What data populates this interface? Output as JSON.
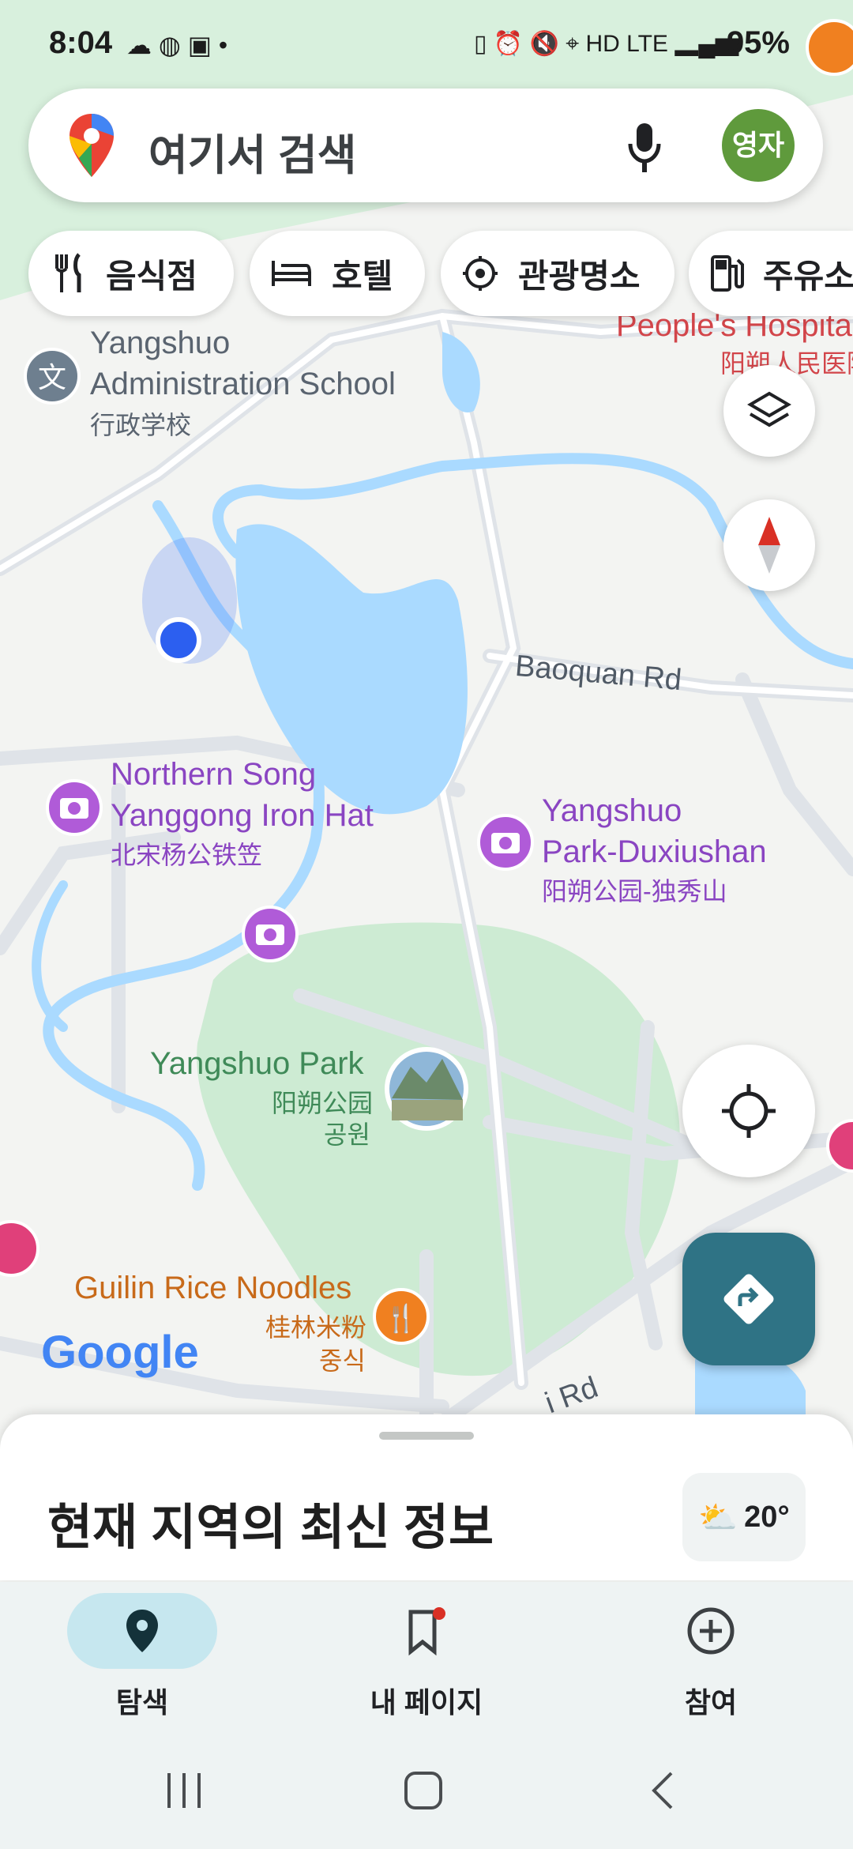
{
  "status_bar": {
    "time": "8:04",
    "battery": "95%"
  },
  "search": {
    "placeholder": "여기서 검색",
    "avatar_text": "영자"
  },
  "chips": [
    {
      "label": "음식점",
      "icon": "fork-knife-icon"
    },
    {
      "label": "호텔",
      "icon": "bed-icon"
    },
    {
      "label": "관광명소",
      "icon": "attraction-icon"
    },
    {
      "label": "주유소",
      "icon": "gas-station-icon"
    }
  ],
  "map": {
    "labels": {
      "admin_school_en1": "Yangshuo",
      "admin_school_en2": "Administration School",
      "admin_school_zh": "行政学校",
      "hospital_en": "People's Hospital",
      "hospital_zh": "阳朔人民医院",
      "baoquan_rd": "Baoquan Rd",
      "northern_song_en1": "Northern Song",
      "northern_song_en2": "Yanggong Iron Hat",
      "northern_song_zh": "北宋杨公铁笠",
      "duxiushan_en1": "Yangshuo",
      "duxiushan_en2": "Park-Duxiushan",
      "duxiushan_zh": "阳朔公园-独秀山",
      "park_en": "Yangshuo Park",
      "park_zh": "阳朔公园",
      "park_ko": "공원",
      "noodles_en": "Guilin Rice Noodles",
      "noodles_zh": "桂林米粉",
      "noodles_ko": "중식",
      "road_bottom": "i Rd",
      "google_logo": "Google"
    }
  },
  "sheet": {
    "title": "현재 지역의 최신 정보",
    "temperature": "20°"
  },
  "bottom_nav": [
    {
      "label": "탐색",
      "active": true
    },
    {
      "label": "내 페이지",
      "active": false
    },
    {
      "label": "참여",
      "active": false
    }
  ],
  "colors": {
    "water": "#aadaff",
    "park": "#cdebd3",
    "accent": "#2f7385",
    "poi_purple": "#b05bd8",
    "poi_orange": "#f08020"
  }
}
